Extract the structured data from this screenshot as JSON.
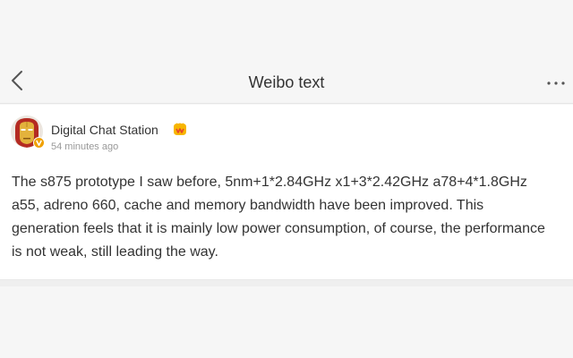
{
  "header": {
    "title": "Weibo text",
    "back_icon": "chevron-left-icon",
    "more_icon": "more-dots-icon"
  },
  "post": {
    "user_name": "Digital Chat Station",
    "time": "54 minutes ago",
    "text": "The s875 prototype I saw before, 5nm+1*2.84GHz x1+3*2.42GHz a78+4*1.8GHz a55, adreno 660, cache and memory bandwidth have been improved. This generation feels that it is mainly low power consumption, of course, the performance is not weak, still leading the way.",
    "avatar_icon": "iron-man-avatar",
    "verified_icon": "verified-badge-icon",
    "member_icon": "member-badge-icon"
  },
  "colors": {
    "background": "#f6f6f6",
    "card": "#ffffff",
    "text": "#333333",
    "secondary_text": "#999999",
    "verified": "#f0a000",
    "member": "#f7b500"
  }
}
